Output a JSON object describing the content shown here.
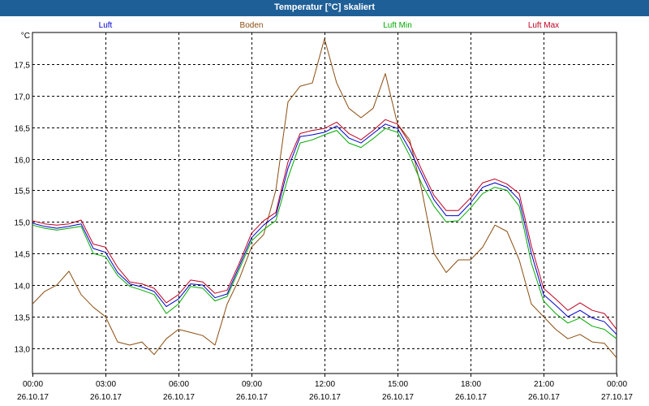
{
  "window": {
    "title": "Temperatur [°C] skaliert"
  },
  "chart_data": {
    "type": "line",
    "title": "Temperatur [°C] skaliert",
    "ylabel": "°C",
    "xlabel": "",
    "ylim": [
      12.6,
      18.0
    ],
    "yticks": [
      13.0,
      13.5,
      14.0,
      14.5,
      15.0,
      15.5,
      16.0,
      16.5,
      17.0,
      17.5
    ],
    "ytick_labels": [
      "13,0",
      "13,5",
      "14,0",
      "14,5",
      "15,0",
      "15,5",
      "16,0",
      "16,5",
      "17,0",
      "17,5"
    ],
    "xlim": [
      "26.10.17 00:00",
      "27.10.17 00:00"
    ],
    "xtick_labels": [
      {
        "time": "00:00",
        "date": "26.10.17"
      },
      {
        "time": "03:00",
        "date": "26.10.17"
      },
      {
        "time": "06:00",
        "date": "26.10.17"
      },
      {
        "time": "09:00",
        "date": "26.10.17"
      },
      {
        "time": "12:00",
        "date": "26.10.17"
      },
      {
        "time": "15:00",
        "date": "26.10.17"
      },
      {
        "time": "18:00",
        "date": "26.10.17"
      },
      {
        "time": "21:00",
        "date": "26.10.17"
      },
      {
        "time": "00:00",
        "date": "27.10.17"
      }
    ],
    "x_hours": [
      0,
      0.5,
      1,
      1.5,
      2,
      2.5,
      3,
      3.5,
      4,
      4.5,
      5,
      5.5,
      6,
      6.5,
      7,
      7.5,
      8,
      8.5,
      9,
      9.5,
      10,
      10.5,
      11,
      11.5,
      12,
      12.5,
      13,
      13.5,
      14,
      14.5,
      15,
      15.5,
      16,
      16.5,
      17,
      17.5,
      18,
      18.5,
      19,
      19.5,
      20,
      20.5,
      21,
      21.5,
      22,
      22.5,
      23,
      23.5,
      24
    ],
    "grid": true,
    "legend": "top",
    "series": [
      {
        "name": "Luft",
        "color": "#0000cc",
        "values": [
          14.98,
          14.93,
          14.9,
          14.93,
          14.97,
          14.58,
          14.52,
          14.2,
          14.02,
          13.97,
          13.9,
          13.66,
          13.78,
          14.02,
          14.0,
          13.8,
          13.86,
          14.3,
          14.75,
          14.95,
          15.1,
          15.85,
          16.35,
          16.38,
          16.42,
          16.52,
          16.33,
          16.25,
          16.4,
          16.55,
          16.48,
          16.15,
          15.75,
          15.35,
          15.1,
          15.1,
          15.3,
          15.55,
          15.62,
          15.55,
          15.35,
          14.5,
          13.85,
          13.68,
          13.5,
          13.6,
          13.48,
          13.42,
          13.22
        ]
      },
      {
        "name": "Boden",
        "color": "#8b4d10",
        "values": [
          13.7,
          13.9,
          14.0,
          14.22,
          13.85,
          13.65,
          13.5,
          13.1,
          13.05,
          13.1,
          12.9,
          13.15,
          13.3,
          13.25,
          13.2,
          13.05,
          13.7,
          14.1,
          14.6,
          14.8,
          15.5,
          16.9,
          17.15,
          17.2,
          17.9,
          17.2,
          16.8,
          16.65,
          16.8,
          17.35,
          16.55,
          16.3,
          15.5,
          14.5,
          14.2,
          14.4,
          14.4,
          14.6,
          14.95,
          14.85,
          14.4,
          13.7,
          13.5,
          13.3,
          13.15,
          13.22,
          13.1,
          13.08,
          12.85
        ]
      },
      {
        "name": "Luft Min",
        "color": "#00aa00",
        "values": [
          14.95,
          14.9,
          14.87,
          14.9,
          14.93,
          14.5,
          14.45,
          14.15,
          13.98,
          13.92,
          13.85,
          13.55,
          13.7,
          13.98,
          13.95,
          13.75,
          13.82,
          14.25,
          14.7,
          14.88,
          15.02,
          15.7,
          16.25,
          16.3,
          16.38,
          16.45,
          16.25,
          16.18,
          16.32,
          16.48,
          16.42,
          16.05,
          15.6,
          15.25,
          15.0,
          15.02,
          15.22,
          15.45,
          15.55,
          15.5,
          15.25,
          14.35,
          13.75,
          13.55,
          13.4,
          13.48,
          13.35,
          13.3,
          13.15
        ]
      },
      {
        "name": "Luft Max",
        "color": "#c00020",
        "values": [
          15.02,
          14.97,
          14.95,
          14.97,
          15.03,
          14.65,
          14.6,
          14.28,
          14.05,
          14.02,
          13.95,
          13.72,
          13.85,
          14.08,
          14.05,
          13.87,
          13.92,
          14.35,
          14.82,
          15.02,
          15.15,
          15.95,
          16.4,
          16.45,
          16.48,
          16.58,
          16.4,
          16.3,
          16.45,
          16.62,
          16.55,
          16.25,
          15.82,
          15.42,
          15.18,
          15.18,
          15.38,
          15.62,
          15.68,
          15.6,
          15.45,
          14.62,
          13.95,
          13.78,
          13.6,
          13.72,
          13.6,
          13.55,
          13.3
        ]
      }
    ]
  }
}
